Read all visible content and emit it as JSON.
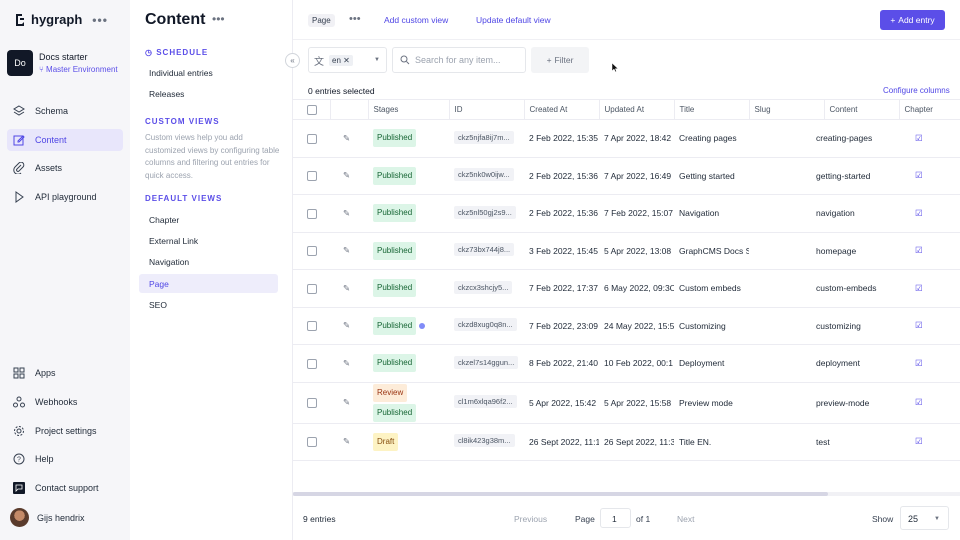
{
  "brand": {
    "name": "hygraph"
  },
  "project": {
    "initials": "Do",
    "name": "Docs starter",
    "environment": "Master Environment"
  },
  "nav": [
    {
      "label": "Schema",
      "icon": "layers-icon"
    },
    {
      "label": "Content",
      "icon": "edit-icon"
    },
    {
      "label": "Assets",
      "icon": "paperclip-icon"
    },
    {
      "label": "API playground",
      "icon": "play-icon"
    }
  ],
  "bottom_nav": [
    {
      "label": "Apps",
      "icon": "grid-icon"
    },
    {
      "label": "Webhooks",
      "icon": "webhook-icon"
    },
    {
      "label": "Project settings",
      "icon": "gear-icon"
    },
    {
      "label": "Help",
      "icon": "help-icon"
    },
    {
      "label": "Contact support",
      "icon": "chat-icon"
    }
  ],
  "user": {
    "name": "Gijs hendrix"
  },
  "views_panel": {
    "title": "Content",
    "schedule_header": "SCHEDULE",
    "schedule_items": [
      "Individual entries",
      "Releases"
    ],
    "custom_header": "CUSTOM VIEWS",
    "custom_desc": "Custom views help you add customized views by configuring table columns and filtering out entries for quick access.",
    "default_header": "DEFAULT VIEWS",
    "default_items": [
      "Chapter",
      "External Link",
      "Navigation",
      "Page",
      "SEO"
    ]
  },
  "topbar": {
    "model_pill": "Page",
    "add_view": "Add custom view",
    "update_view": "Update default view",
    "add_entry": "Add entry"
  },
  "toolbar": {
    "locale": "en",
    "search_placeholder": "Search for any item...",
    "filter": "Filter"
  },
  "selection": {
    "text": "0 entries selected",
    "configure": "Configure columns"
  },
  "table": {
    "columns": [
      "Stages",
      "ID",
      "Created At",
      "Updated At",
      "Title",
      "Slug",
      "Content",
      "Chapter"
    ],
    "rows": [
      {
        "stages": [
          "Published"
        ],
        "dot": false,
        "id": "ckz5njfa8ij7m...",
        "created": "2 Feb 2022, 15:35",
        "updated": "7 Apr 2022, 18:42",
        "title": "Creating pages",
        "slug": "creating-pages"
      },
      {
        "stages": [
          "Published"
        ],
        "dot": false,
        "id": "ckz5nk0w0ijw...",
        "created": "2 Feb 2022, 15:36",
        "updated": "7 Apr 2022, 16:49",
        "title": "Getting started",
        "slug": "getting-started"
      },
      {
        "stages": [
          "Published"
        ],
        "dot": false,
        "id": "ckz5nl50gj2s9...",
        "created": "2 Feb 2022, 15:36",
        "updated": "7 Feb 2022, 15:07",
        "title": "Navigation",
        "slug": "navigation"
      },
      {
        "stages": [
          "Published"
        ],
        "dot": false,
        "id": "ckz73bx744j8...",
        "created": "3 Feb 2022, 15:45",
        "updated": "5 Apr 2022, 13:08",
        "title": "GraphCMS Docs S",
        "slug": "homepage"
      },
      {
        "stages": [
          "Published"
        ],
        "dot": false,
        "id": "ckzcx3shcjy5...",
        "created": "7 Feb 2022, 17:37",
        "updated": "6 May 2022, 09:3C",
        "title": "Custom embeds",
        "slug": "custom-embeds"
      },
      {
        "stages": [
          "Published"
        ],
        "dot": true,
        "id": "ckzd8xug0q8n...",
        "created": "7 Feb 2022, 23:09",
        "updated": "24 May 2022, 15:5",
        "title": "Customizing",
        "slug": "customizing"
      },
      {
        "stages": [
          "Published"
        ],
        "dot": false,
        "id": "ckzel7s14ggun...",
        "created": "8 Feb 2022, 21:40",
        "updated": "10 Feb 2022, 00:1",
        "title": "Deployment",
        "slug": "deployment"
      },
      {
        "stages": [
          "Review",
          "Published"
        ],
        "dot": false,
        "id": "cl1m6xlqa96f2...",
        "created": "5 Apr 2022, 15:42",
        "updated": "5 Apr 2022, 15:58",
        "title": "Preview mode",
        "slug": "preview-mode"
      },
      {
        "stages": [
          "Draft"
        ],
        "dot": false,
        "id": "cl8ik423g38m...",
        "created": "26 Sept 2022, 11:1",
        "updated": "26 Sept 2022, 11:3",
        "title": "Title EN.",
        "slug": "test"
      }
    ]
  },
  "footer": {
    "entries": "9 entries",
    "previous": "Previous",
    "page_label": "Page",
    "page_value": "1",
    "of": "of 1",
    "next": "Next",
    "show_label": "Show",
    "show_value": "25"
  },
  "colors": {
    "accent": "#5b4ee8",
    "published_bg": "#dcf5e7",
    "review_bg": "#fdecd9",
    "draft_bg": "#fdf3c4"
  }
}
